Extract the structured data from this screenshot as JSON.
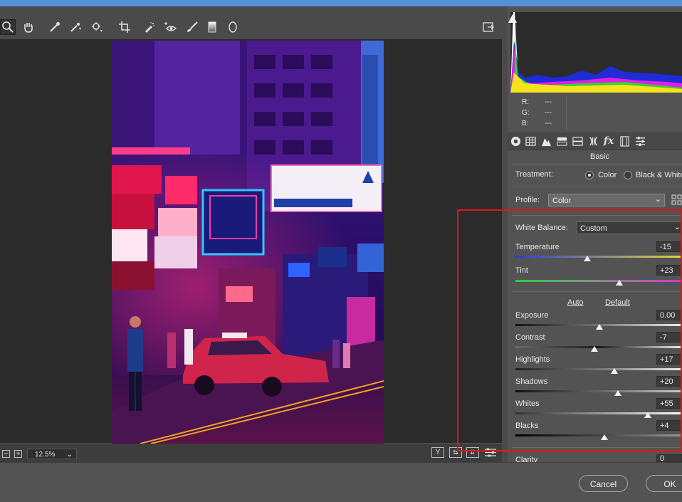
{
  "toolbar": {
    "tools": [
      "zoom-tool-icon",
      "hand-tool-icon",
      "white-balance-tool-icon",
      "color-sampler-tool-icon",
      "targeted-adjustment-tool-icon",
      "crop-tool-icon",
      "spot-removal-tool-icon",
      "red-eye-tool-icon",
      "adjustment-brush-icon",
      "graduated-filter-icon",
      "radial-filter-icon"
    ]
  },
  "histogram": {
    "r_label": "R:",
    "g_label": "G:",
    "b_label": "B:",
    "r_value": "---",
    "g_value": "---",
    "b_value": "---"
  },
  "panel": {
    "section_title": "Basic",
    "treatment_label": "Treatment:",
    "treatment_color": "Color",
    "treatment_bw": "Black & White",
    "profile_label": "Profile:",
    "profile_value": "Color",
    "wb_label": "White Balance:",
    "wb_value": "Custom",
    "auto_label": "Auto",
    "default_label": "Default"
  },
  "sliders": {
    "temperature": {
      "label": "Temperature",
      "value": "-15",
      "level": 0.43
    },
    "tint": {
      "label": "Tint",
      "value": "+23",
      "level": 0.62
    },
    "exposure": {
      "label": "Exposure",
      "value": "0.00",
      "level": 0.5
    },
    "contrast": {
      "label": "Contrast",
      "value": "-7",
      "level": 0.47
    },
    "highlights": {
      "label": "Highlights",
      "value": "+17",
      "level": 0.59
    },
    "shadows": {
      "label": "Shadows",
      "value": "+20",
      "level": 0.61
    },
    "whites": {
      "label": "Whites",
      "value": "+55",
      "level": 0.79
    },
    "blacks": {
      "label": "Blacks",
      "value": "+4",
      "level": 0.53
    },
    "clarity": {
      "label": "Clarity",
      "value": "0"
    }
  },
  "bottombar": {
    "zoom": "12.5%"
  },
  "footer": {
    "cancel": "Cancel",
    "ok": "OK"
  },
  "colors": {
    "highlight_box": "#e4141b",
    "panel_bg": "#535353",
    "canvas_bg": "#2b2b2b"
  }
}
